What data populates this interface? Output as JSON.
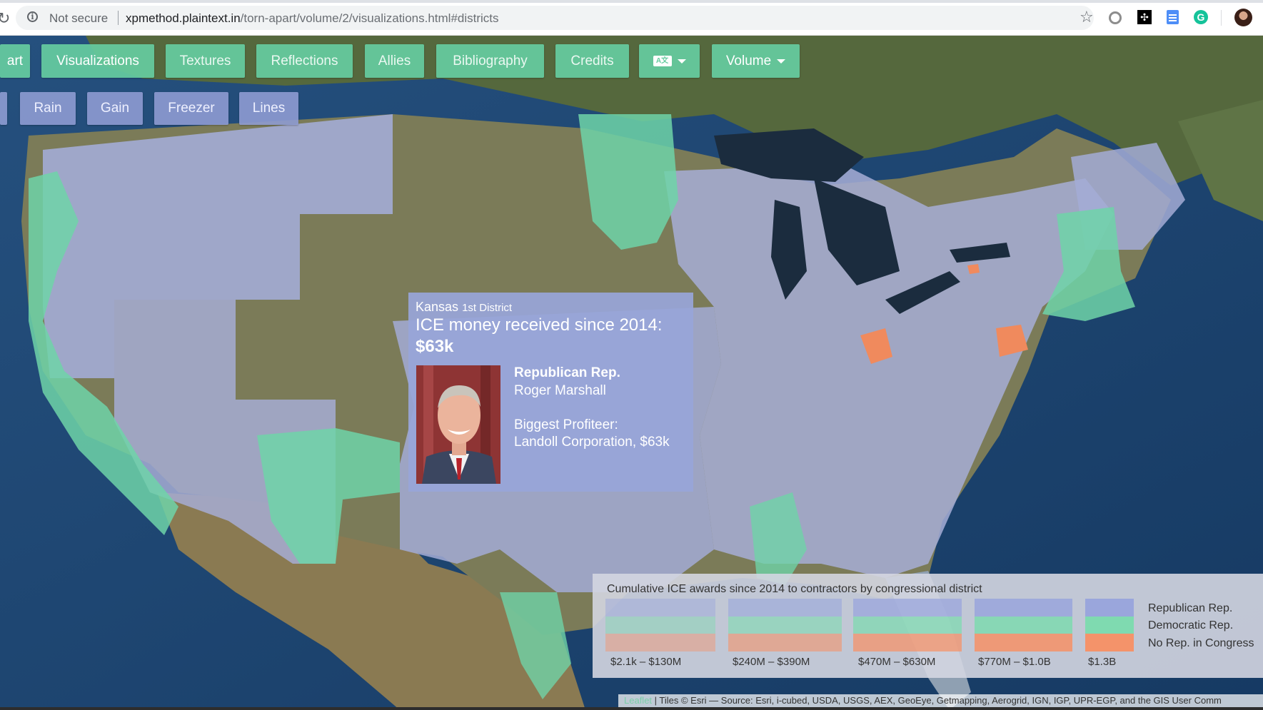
{
  "browser": {
    "security_label": "Not secure",
    "url_host": "xpmethod.plaintext.in",
    "url_path": "/torn-apart/volume/2/visualizations.html#districts"
  },
  "nav": {
    "items": [
      {
        "label": "art"
      },
      {
        "label": "Visualizations"
      },
      {
        "label": "Textures"
      },
      {
        "label": "Reflections"
      },
      {
        "label": "Allies"
      },
      {
        "label": "Bibliography"
      },
      {
        "label": "Credits"
      },
      {
        "label": "A文"
      },
      {
        "label": "Volume"
      }
    ]
  },
  "subnav": {
    "items": [
      {
        "label": "Rain"
      },
      {
        "label": "Gain"
      },
      {
        "label": "Freezer"
      },
      {
        "label": "Lines"
      }
    ]
  },
  "popup": {
    "state": "Kansas",
    "district": "1st District",
    "headline": "ICE money received since 2014:",
    "amount": "$63k",
    "party": "Republican Rep.",
    "representative": "Roger Marshall",
    "profiteer_label": "Biggest Profiteer:",
    "profiteer": "Landoll Corporation, $63k"
  },
  "legend": {
    "title": "Cumulative ICE awards since 2014 to contractors by congressional district",
    "ranges": [
      "$2.1k – $130M",
      "$240M – $390M",
      "$470M – $630M",
      "$770M – $1.0B",
      "$1.3B"
    ],
    "keys": [
      "Republican Rep.",
      "Democratic Rep.",
      "No Rep. in Congress"
    ],
    "colors": {
      "republican": "#9aa6dc",
      "democratic": "#7fdab0",
      "none": "#f4936a"
    }
  },
  "attribution": {
    "leaflet": "Leaflet",
    "tiles": " | Tiles © Esri — Source: Esri, i-cubed, USDA, USGS, AEX, GeoEye, Getmapping, Aerogrid, IGN, IGP, UPR-EGP, and the GIS User Comm"
  }
}
